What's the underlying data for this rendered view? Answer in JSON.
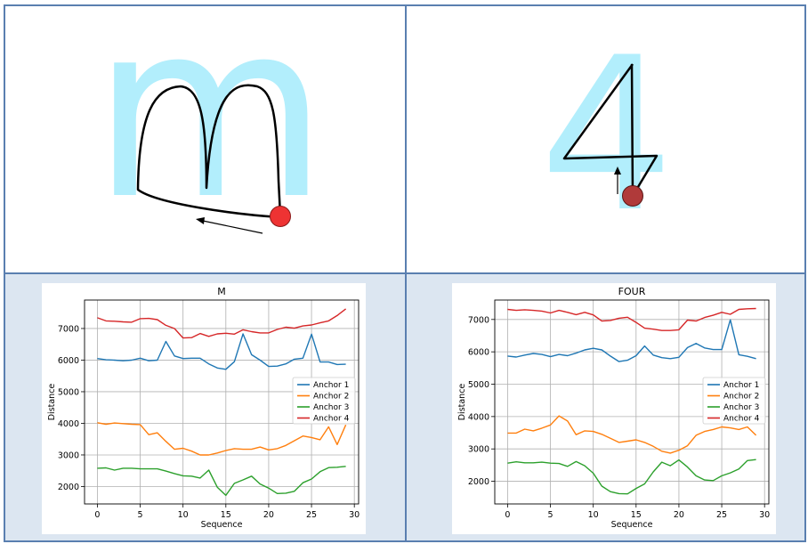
{
  "panels": [
    {
      "glyph": "m"
    },
    {
      "glyph": "4"
    }
  ],
  "colors": {
    "glyph": "#b2eefc",
    "stroke_path": "#000000",
    "marker_m": "#ee3333",
    "marker_four": "#b03a3a",
    "anchor_1": "#1f77b4",
    "anchor_2": "#ff7f0e",
    "anchor_3": "#2ca02c",
    "anchor_4": "#d62728"
  },
  "chart_data": [
    {
      "type": "line",
      "title": "M",
      "xlabel": "Sequence",
      "ylabel": "Distance",
      "xlim": [
        -1.5,
        30.5
      ],
      "ylim": [
        1450,
        7900
      ],
      "xticks": [
        0,
        5,
        10,
        15,
        20,
        25,
        30
      ],
      "yticks": [
        2000,
        3000,
        4000,
        5000,
        6000,
        7000
      ],
      "grid": true,
      "legend": "center-right",
      "x": [
        0,
        1,
        2,
        3,
        4,
        5,
        6,
        7,
        8,
        9,
        10,
        11,
        12,
        13,
        14,
        15,
        16,
        17,
        18,
        19,
        20,
        21,
        22,
        23,
        24,
        25,
        26,
        27,
        28,
        29
      ],
      "series": [
        {
          "name": "Anchor 1",
          "color": "#1f77b4",
          "values": [
            6050,
            6010,
            6000,
            5980,
            6000,
            6060,
            5980,
            6000,
            6590,
            6130,
            6050,
            6060,
            6060,
            5880,
            5750,
            5710,
            5950,
            6830,
            6170,
            6000,
            5800,
            5810,
            5880,
            6030,
            6060,
            6820,
            5940,
            5940,
            5860,
            5870
          ]
        },
        {
          "name": "Anchor 2",
          "color": "#ff7f0e",
          "values": [
            4020,
            3970,
            4010,
            3990,
            3970,
            3960,
            3640,
            3700,
            3430,
            3180,
            3210,
            3120,
            3000,
            3000,
            3060,
            3140,
            3200,
            3180,
            3180,
            3250,
            3160,
            3200,
            3300,
            3450,
            3600,
            3550,
            3480,
            3890,
            3330,
            3950
          ]
        },
        {
          "name": "Anchor 3",
          "color": "#2ca02c",
          "values": [
            2580,
            2590,
            2520,
            2580,
            2580,
            2560,
            2560,
            2560,
            2490,
            2410,
            2340,
            2330,
            2270,
            2520,
            1980,
            1720,
            2100,
            2210,
            2330,
            2080,
            1950,
            1780,
            1790,
            1850,
            2120,
            2240,
            2470,
            2600,
            2610,
            2640
          ]
        },
        {
          "name": "Anchor 4",
          "color": "#d62728",
          "values": [
            7340,
            7240,
            7230,
            7210,
            7200,
            7310,
            7320,
            7280,
            7100,
            7000,
            6700,
            6710,
            6840,
            6750,
            6830,
            6850,
            6820,
            6960,
            6900,
            6860,
            6860,
            6970,
            7040,
            7010,
            7080,
            7110,
            7180,
            7240,
            7410,
            7620
          ]
        }
      ]
    },
    {
      "type": "line",
      "title": "FOUR",
      "xlabel": "Sequence",
      "ylabel": "Distance",
      "xlim": [
        -1.5,
        30.5
      ],
      "ylim": [
        1300,
        7600
      ],
      "xticks": [
        0,
        5,
        10,
        15,
        20,
        25,
        30
      ],
      "yticks": [
        2000,
        3000,
        4000,
        5000,
        6000,
        7000
      ],
      "grid": true,
      "legend": "center-right",
      "x": [
        0,
        1,
        2,
        3,
        4,
        5,
        6,
        7,
        8,
        9,
        10,
        11,
        12,
        13,
        14,
        15,
        16,
        17,
        18,
        19,
        20,
        21,
        22,
        23,
        24,
        25,
        26,
        27,
        28,
        29
      ],
      "series": [
        {
          "name": "Anchor 1",
          "color": "#1f77b4",
          "values": [
            5870,
            5840,
            5900,
            5950,
            5920,
            5850,
            5920,
            5880,
            5960,
            6060,
            6110,
            6060,
            5870,
            5700,
            5740,
            5880,
            6180,
            5900,
            5820,
            5790,
            5830,
            6130,
            6260,
            6120,
            6070,
            6070,
            6990,
            5910,
            5860,
            5790
          ]
        },
        {
          "name": "Anchor 2",
          "color": "#ff7f0e",
          "values": [
            3490,
            3490,
            3610,
            3560,
            3640,
            3740,
            4020,
            3860,
            3440,
            3560,
            3540,
            3450,
            3330,
            3200,
            3240,
            3280,
            3200,
            3080,
            2930,
            2870,
            2960,
            3100,
            3420,
            3540,
            3600,
            3680,
            3650,
            3600,
            3680,
            3420
          ]
        },
        {
          "name": "Anchor 3",
          "color": "#2ca02c",
          "values": [
            2560,
            2600,
            2570,
            2570,
            2590,
            2560,
            2550,
            2460,
            2610,
            2480,
            2250,
            1850,
            1680,
            1620,
            1610,
            1780,
            1920,
            2290,
            2590,
            2480,
            2660,
            2440,
            2170,
            2040,
            2020,
            2170,
            2260,
            2380,
            2640,
            2670
          ]
        },
        {
          "name": "Anchor 4",
          "color": "#d62728",
          "values": [
            7310,
            7280,
            7300,
            7280,
            7260,
            7200,
            7280,
            7220,
            7150,
            7220,
            7140,
            6950,
            6970,
            7040,
            7070,
            6910,
            6730,
            6700,
            6660,
            6660,
            6680,
            6980,
            6950,
            7060,
            7130,
            7220,
            7160,
            7310,
            7330,
            7340
          ]
        }
      ]
    }
  ]
}
